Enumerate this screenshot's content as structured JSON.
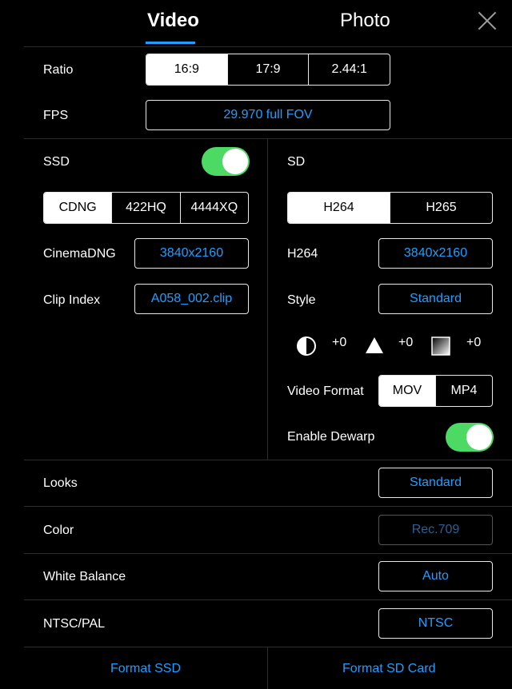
{
  "tabs": {
    "video": "Video",
    "photo": "Photo"
  },
  "ratio": {
    "label": "Ratio",
    "options": [
      "16:9",
      "17:9",
      "2.44:1"
    ],
    "selected": "16:9"
  },
  "fps": {
    "label": "FPS",
    "value": "29.970 full FOV"
  },
  "ssd": {
    "label": "SSD",
    "enabled": true,
    "codecs": [
      "CDNG",
      "422HQ",
      "4444XQ"
    ],
    "selected_codec": "CDNG",
    "cinemadng_label": "CinemaDNG",
    "cinemadng_value": "3840x2160",
    "clip_index_label": "Clip Index",
    "clip_index_value": "A058_002.clip"
  },
  "sd": {
    "label": "SD",
    "codecs": [
      "H264",
      "H265"
    ],
    "selected_codec": "H264",
    "h264_label": "H264",
    "h264_value": "3840x2160",
    "style_label": "Style",
    "style_value": "Standard",
    "contrast_value": "+0",
    "sharpness_value": "+0",
    "saturation_value": "+0",
    "video_format_label": "Video Format",
    "video_formats": [
      "MOV",
      "MP4"
    ],
    "selected_format": "MOV",
    "dewarp_label": "Enable Dewarp",
    "dewarp_enabled": true
  },
  "looks": {
    "label": "Looks",
    "value": "Standard"
  },
  "color": {
    "label": "Color",
    "value": "Rec.709"
  },
  "white_balance": {
    "label": "White Balance",
    "value": "Auto"
  },
  "ntsc_pal": {
    "label": "NTSC/PAL",
    "value": "NTSC"
  },
  "footer": {
    "format_ssd": "Format SSD",
    "format_sd": "Format SD Card"
  },
  "colors": {
    "accent": "#1e9fff",
    "toggle_on": "#4cd964",
    "background": "#000000"
  },
  "icons": {
    "contrast": "contrast-icon",
    "sharpness": "sharpness-icon",
    "saturation": "saturation-icon",
    "close": "close-icon"
  }
}
